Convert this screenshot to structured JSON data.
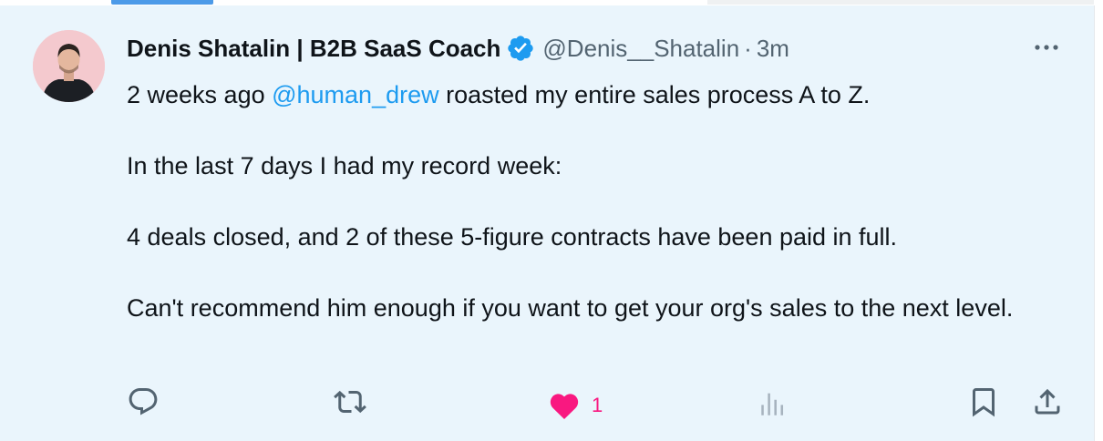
{
  "tweet": {
    "author": {
      "display_name": "Denis Shatalin | B2B SaaS Coach",
      "handle": "@Denis__Shatalin",
      "separator": "·",
      "timestamp": "3m",
      "verified": true
    },
    "body": {
      "line1_prefix": "2 weeks ago ",
      "mention": "@human_drew",
      "line1_suffix": " roasted my entire sales process A to Z.",
      "para2": "In the last 7 days I had my record week:",
      "para3": "4 deals closed, and 2 of these 5-figure contracts have been paid in full.",
      "para4": "Can't recommend him enough if you want to get your org's sales to the next level."
    },
    "actions": {
      "like_count": "1",
      "liked": true
    }
  },
  "colors": {
    "background": "#eaf5fc",
    "accent": "#1d9bf0",
    "like": "#f91880",
    "secondary_text": "#536471"
  },
  "icons": [
    "verified-badge-icon",
    "more-icon",
    "reply-icon",
    "retweet-icon",
    "heart-icon",
    "views-icon",
    "bookmark-icon",
    "share-icon"
  ]
}
